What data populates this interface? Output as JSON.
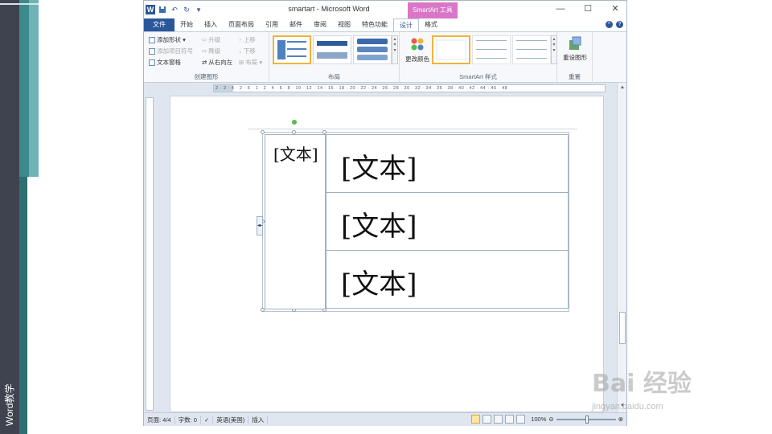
{
  "side_label": "Word教学",
  "window": {
    "title": "smartart - Microsoft Word",
    "contextual_tab_header": "SmartArt 工具",
    "controls": {
      "minimize": "—",
      "maximize": "☐",
      "close": "✕"
    }
  },
  "qat": {
    "logo": "W",
    "save": "💾",
    "undo": "↶",
    "redo": "↻",
    "more": "▾"
  },
  "tabs": [
    "文件",
    "开始",
    "插入",
    "页面布局",
    "引用",
    "邮件",
    "审阅",
    "视图",
    "特色功能",
    "设计",
    "格式"
  ],
  "ribbon": {
    "create_group": {
      "label": "创建图形",
      "add_shape": "添加形状 ▾",
      "add_bullet": "添加项目符号",
      "text_pane": "文本窗格",
      "promote": "升级",
      "demote": "降级",
      "right_to_left": "从右向左",
      "move_up": "上移",
      "move_down": "下移",
      "layout": "布局 ▾"
    },
    "layout_group": {
      "label": "布局"
    },
    "styles_group": {
      "label": "SmartArt 样式",
      "change_colors": "更改颜色"
    },
    "reset_group": {
      "label": "重置",
      "reset_graphic": "重设图形"
    }
  },
  "ruler": {
    "horizontal": "2 · 2 · 4 · 2 · 6 · 1 · 2 · 4 · 6 · 8 · 10 · 12 · 14 · 16 · 18 · 20 · 22 · 24 · 26 · 28 · 30 · 32 · 34 · 36 · 38 · 40 · 42 · 44 · 46 · 48"
  },
  "smartart": {
    "left_text": "[文本]",
    "rows": [
      "[文本]",
      "[文本]",
      "[文本]"
    ]
  },
  "status": {
    "page": "页面: 4/4",
    "words": "字数: 0",
    "language": "英语(美国)",
    "mode": "插入",
    "zoom": "100%"
  },
  "watermark": {
    "text": "Bai 经验",
    "url": "jingyan.baidu.com"
  }
}
